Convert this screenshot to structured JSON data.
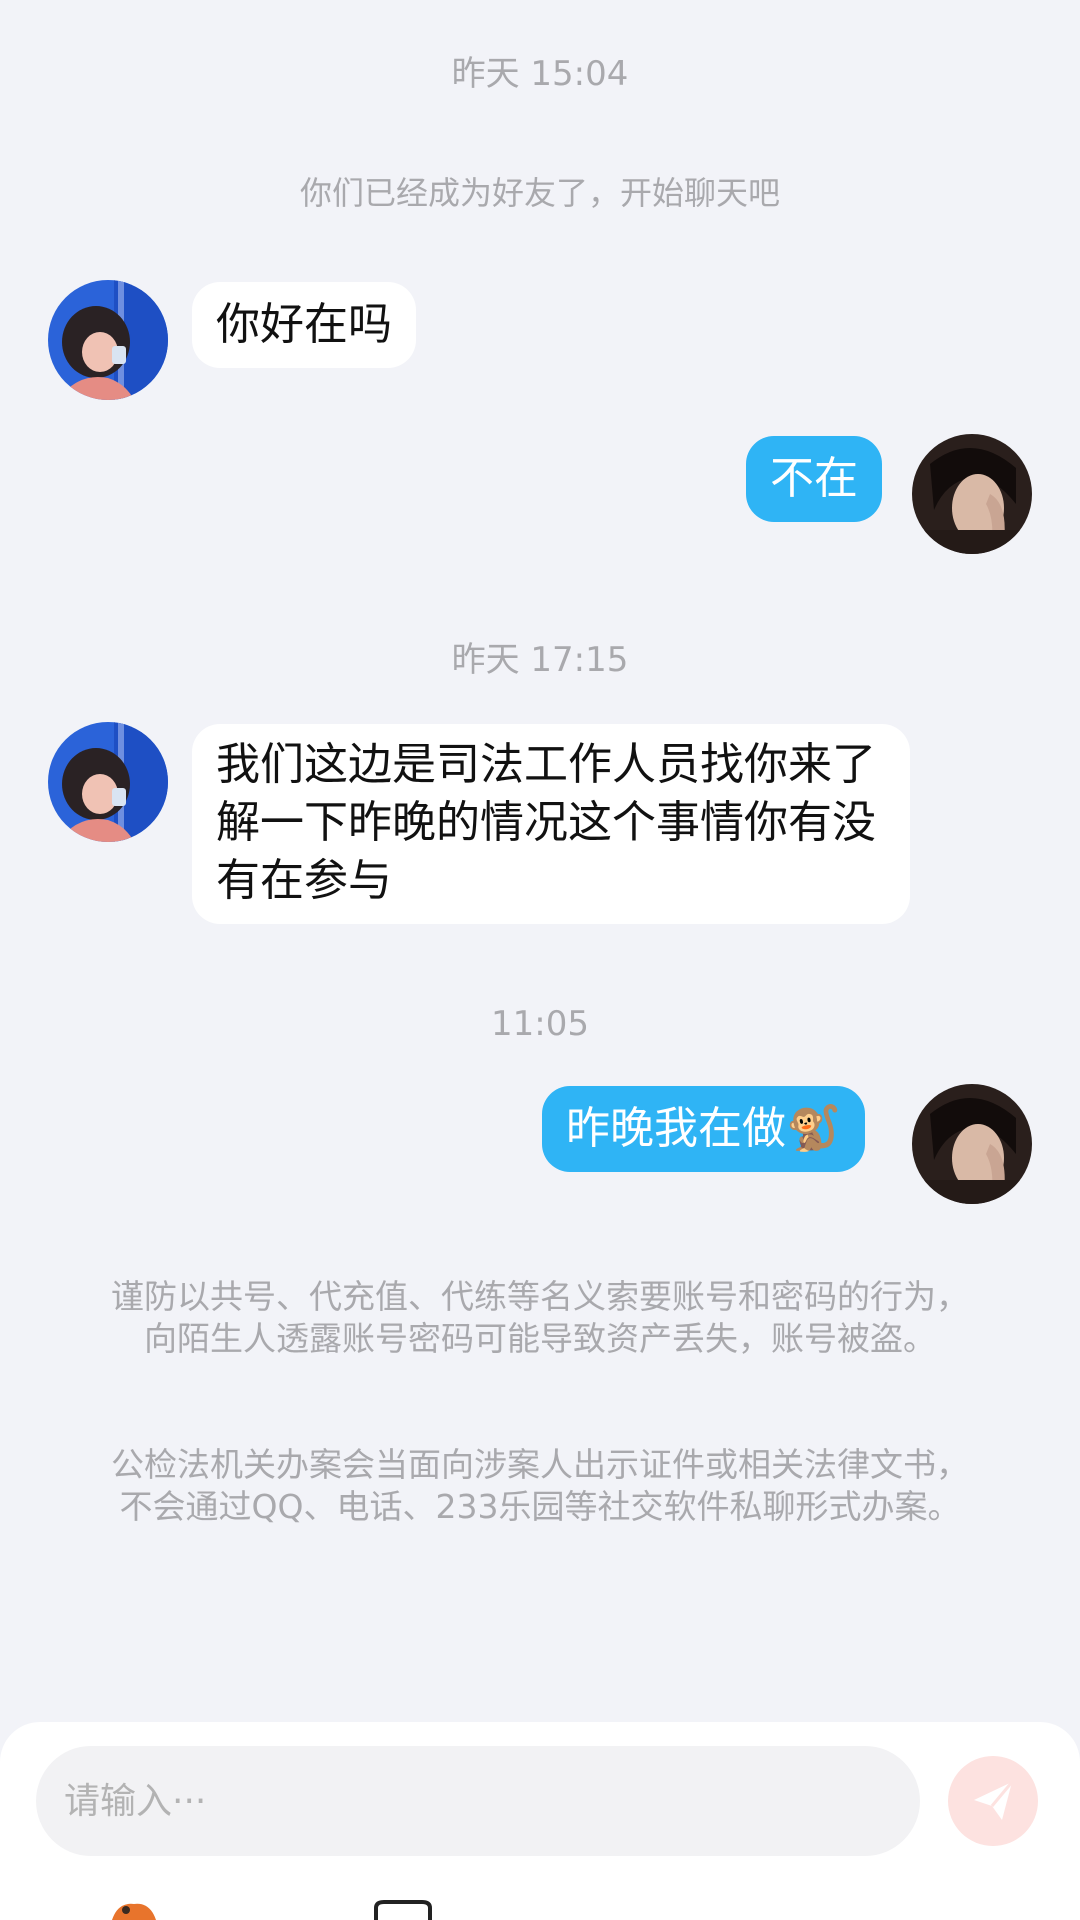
{
  "chat": {
    "system_friend_note": "你们已经成为好友了，开始聊天吧",
    "groups": [
      {
        "time": "昨天 15:04",
        "messages": [
          {
            "from": "other",
            "text": "你好在吗"
          },
          {
            "from": "me",
            "text": "不在"
          }
        ]
      },
      {
        "time": "昨天 17:15",
        "messages": [
          {
            "from": "other",
            "text": "我们这边是司法工作人员找你来了解一下昨晚的情况这个事情你有没有在参与"
          }
        ]
      },
      {
        "time": "11:05",
        "messages": [
          {
            "from": "me",
            "text": "昨晚我在做🐒"
          }
        ]
      }
    ],
    "warnings": [
      "谨防以共号、代充值、代练等名义索要账号和密码的行为，向陌生人透露账号密码可能导致资产丢失，账号被盗。",
      "公检法机关办案会当面向涉案人出示证件或相关法律文书，不会通过QQ、电话、233乐园等社交软件私聊形式办案。"
    ]
  },
  "composer": {
    "placeholder": "请输入···",
    "send_icon": "paper-plane-icon",
    "send_color": "#fde2e0"
  },
  "colors": {
    "background": "#f2f3f8",
    "outgoing_bubble": "#2fb4f5",
    "incoming_bubble": "#ffffff",
    "meta_text": "#a9a9ad"
  }
}
